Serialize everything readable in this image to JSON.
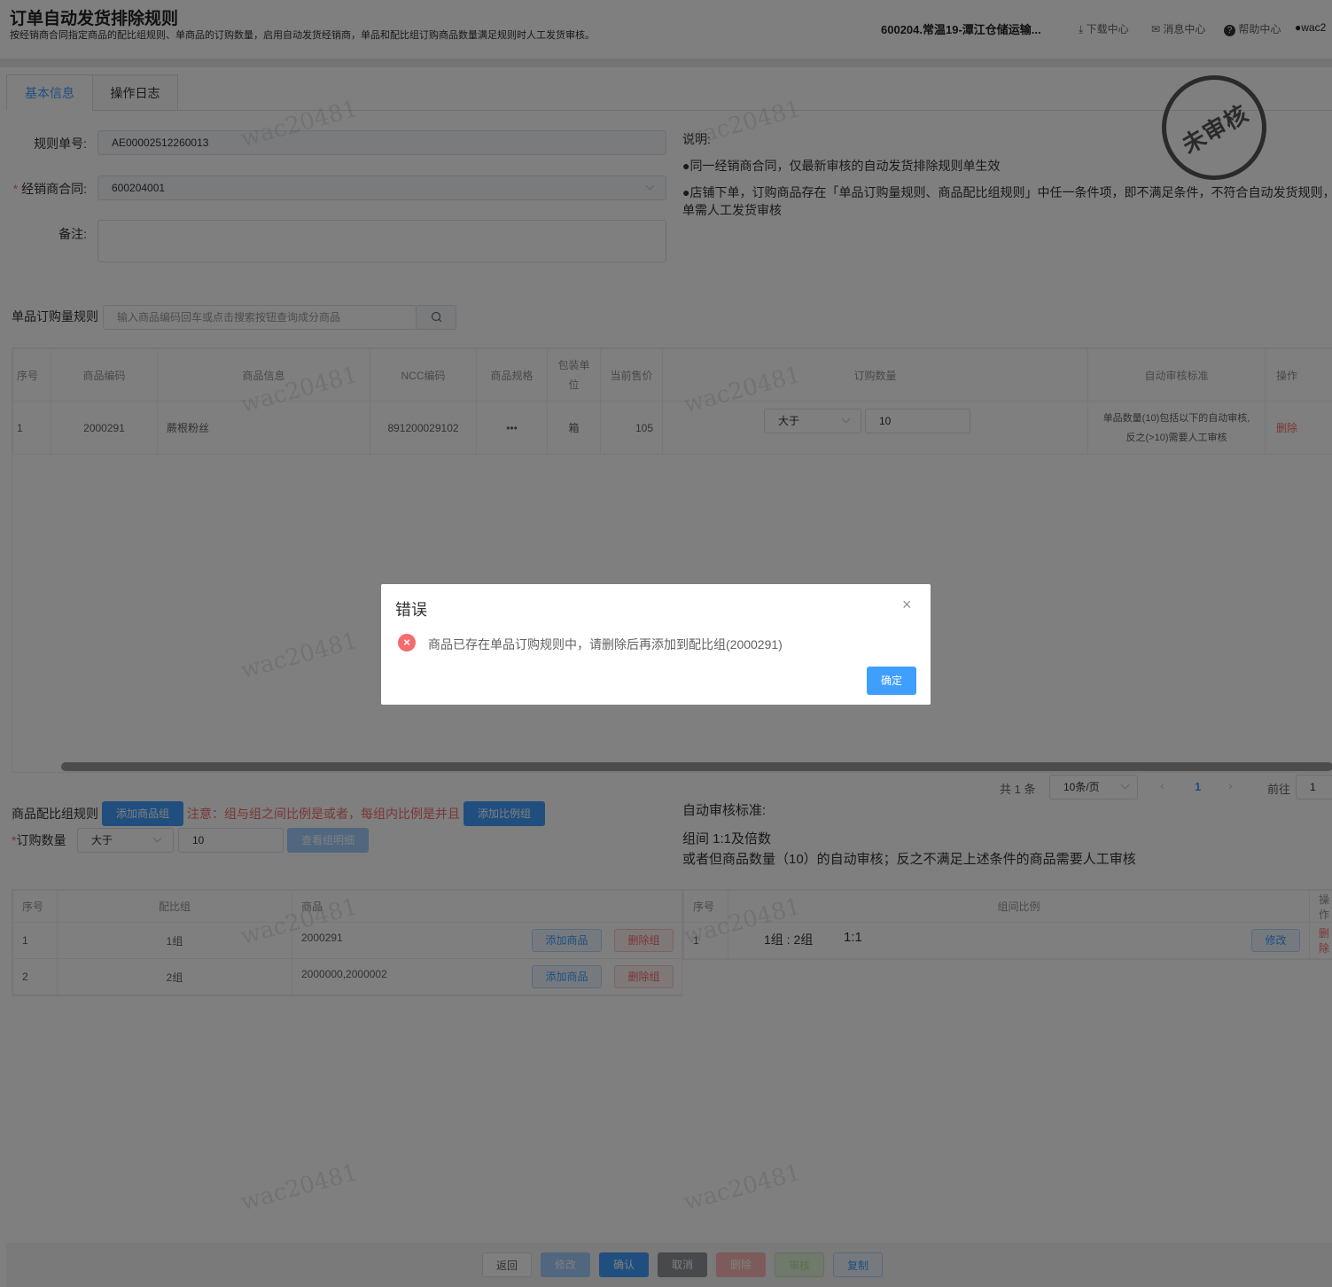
{
  "header": {
    "title": "订单自动发货排除规则",
    "subtitle": "按经销商合同指定商品的配比组规则、单商品的订购数量，启用自动发货经销商，单品和配比组订购商品数量满足规则时人工发货审核。",
    "company": "600204.常温19-潭江仓储运输...",
    "download": "下载中心",
    "messages": "消息中心",
    "help": "帮助中心",
    "user": "wac2"
  },
  "tabs": [
    "基本信息",
    "操作日志"
  ],
  "form": {
    "rule_no_label": "规则单号:",
    "rule_no": "AE00002512260013",
    "contract_label": "经销商合同:",
    "contract": "600204001",
    "remark_label": "备注:"
  },
  "notes": {
    "title": "说明:",
    "line1": "●同一经销商合同，仅最新审核的自动发货排除规则单生效",
    "line2": "●店铺下单，订购商品存在「单品订购量规则、商品配比组规则」中任一条件项，即不满足条件，不符合自动发货规则，",
    "line3": "单需人工发货审核"
  },
  "stamp": "未审核",
  "watermark": "wac20481",
  "single_rule": {
    "label": "单品订购量规则",
    "search_placeholder": "输入商品编码回车或点击搜索按钮查询成分商品",
    "columns": [
      "序号",
      "商品编码",
      "商品信息",
      "NCC编码",
      "商品规格",
      "包装单位",
      "当前售价",
      "订购数量",
      "自动审核标准",
      "操作"
    ],
    "rows": [
      {
        "no": "1",
        "code": "2000291",
        "info": "蕨根粉丝",
        "ncc": "891200029102",
        "spec": "•••",
        "unit": "箱",
        "price": "105",
        "op": "大于",
        "qty": "10",
        "standard": "单品数量(10)包括以下的自动审核,反之(>10)需要人工审核",
        "action": "删除"
      }
    ],
    "pagination": {
      "total": "共 1 条",
      "page_size": "10条/页",
      "current": "1",
      "goto_label": "前往",
      "goto_value": "1"
    }
  },
  "group_rule": {
    "label": "商品配比组规则",
    "add_group": "添加商品组",
    "warning": "注意：组与组之间比例是或者，每组内比例是并且",
    "add_ratio": "添加比例组",
    "qty_label": "订购数量",
    "op": "大于",
    "qty": "10",
    "view_detail": "查看组明细",
    "standard_title": "自动审核标准:",
    "standard_line1": "组间 1:1及倍数",
    "standard_line2": "或者但商品数量（10）的自动审核；反之不满足上述条件的商品需要人工审核",
    "left_columns": [
      "序号",
      "配比组",
      "商品"
    ],
    "left_rows": [
      {
        "no": "1",
        "group": "1组",
        "goods": "2000291",
        "add": "添加商品",
        "del": "删除组"
      },
      {
        "no": "2",
        "group": "2组",
        "goods": "2000000,2000002",
        "add": "添加商品",
        "del": "删除组"
      }
    ],
    "right_columns": [
      "序号",
      "组间比例",
      "操作"
    ],
    "right_rows": [
      {
        "no": "1",
        "ratio_groups": "1组 : 2组",
        "ratio": "1:1",
        "edit": "修改",
        "del": "删除"
      }
    ]
  },
  "footer": [
    "返回",
    "修改",
    "确认",
    "取消",
    "删除",
    "审核",
    "复制"
  ],
  "dialog": {
    "title": "错误",
    "message": "商品已存在单品订购规则中，请删除后再添加到配比组(2000291)",
    "ok": "确定"
  }
}
